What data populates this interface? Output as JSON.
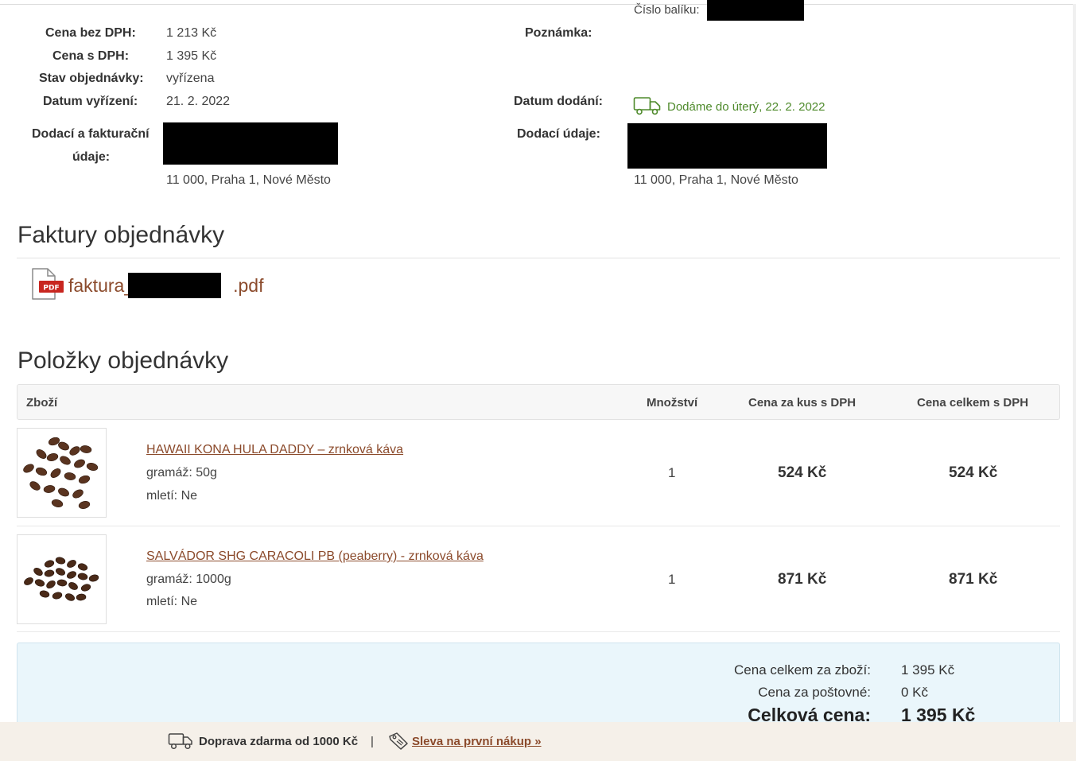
{
  "order": {
    "package_label": "Číslo balíku:",
    "price_without_vat_label": "Cena bez DPH:",
    "price_without_vat": "1 213 Kč",
    "price_with_vat_label": "Cena s DPH:",
    "price_with_vat": "1 395 Kč",
    "status_label": "Stav objednávky:",
    "status": "vyřízena",
    "completed_label": "Datum vyřízení:",
    "completed": "21. 2. 2022",
    "note_label": "Poznámka:",
    "delivery_date_label": "Datum dodání:",
    "delivery_date": "Dodáme do úterý, 22. 2. 2022",
    "billing_label_1": "Dodací a fakturační",
    "billing_label_2": "údaje:",
    "billing_city": "11 000, Praha 1, Nové Město",
    "shipping_label": "Dodací údaje:",
    "shipping_city": "11 000, Praha 1, Nové Město"
  },
  "invoices": {
    "title": "Faktury objednávky",
    "file_prefix": "faktura_",
    "file_suffix": ".pdf",
    "pdf_badge": "PDF"
  },
  "items": {
    "title": "Položky objednávky",
    "headers": {
      "product": "Zboží",
      "quantity": "Množství",
      "unit_price": "Cena za kus s DPH",
      "total_price": "Cena celkem s DPH"
    },
    "rows": [
      {
        "name": "HAWAII KONA HULA DADDY – zrnková káva",
        "weight": "gramáž: 50g",
        "grind": "mletí: Ne",
        "quantity": "1",
        "unit_price": "524 Kč",
        "total_price": "524 Kč"
      },
      {
        "name": "SALVÁDOR SHG CARACOLI PB (peaberry) - zrnková káva",
        "weight": "gramáž: 1000g",
        "grind": "mletí: Ne",
        "quantity": "1",
        "unit_price": "871 Kč",
        "total_price": "871 Kč"
      }
    ]
  },
  "summary": {
    "goods_label": "Cena celkem za zboží:",
    "goods_value": "1 395 Kč",
    "shipping_label": "Cena za poštovné:",
    "shipping_value": "0 Kč",
    "total_label": "Celková cena:",
    "total_value": "1 395 Kč"
  },
  "footer": {
    "free_shipping": "Doprava zdarma od 1000 Kč",
    "separator": "|",
    "discount_link": "Sleva na první nákup »"
  },
  "colors": {
    "link": "#8b4a2b",
    "delivery_green": "#4e8a2b",
    "summary_bg": "#eaf6fb",
    "footer_bg": "#f5f0e9"
  }
}
